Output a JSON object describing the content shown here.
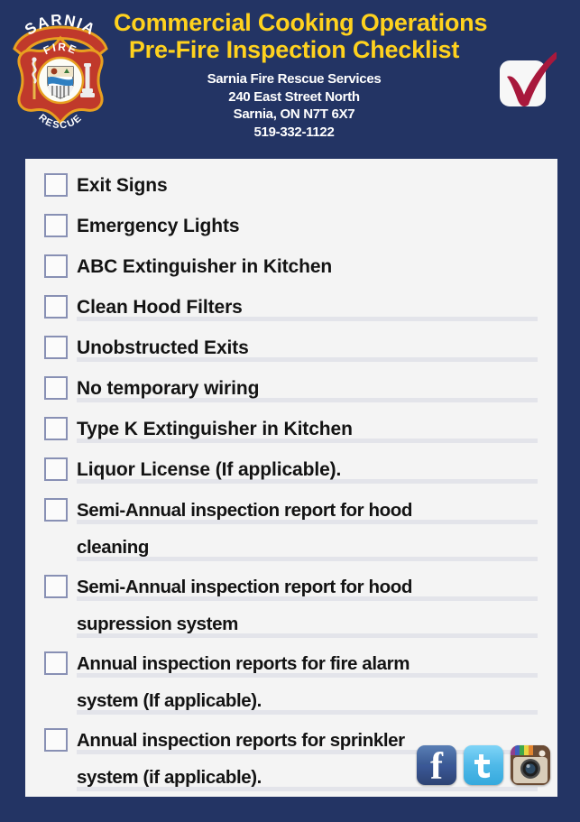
{
  "document": {
    "background_color": "#233464",
    "panel_color": "#F4F4F4",
    "accent_yellow": "#FFD21E",
    "checkmark_color": "#A8183C"
  },
  "header": {
    "title_line_1": "Commercial Cooking Operations",
    "title_line_2": "Pre-Fire Inspection Checklist",
    "crest_text": {
      "top_band": "SARNIA",
      "upper": "FIRE",
      "lower": "RESCUE"
    },
    "address": [
      "Sarnia Fire Rescue Services",
      "240 East Street North",
      "Sarnia, ON N7T 6X7",
      "519-332-1122"
    ],
    "check_logo_name": "checkmark-logo"
  },
  "checklist": {
    "items": [
      {
        "lines": [
          "Exit Signs"
        ],
        "rules": 0
      },
      {
        "lines": [
          "Emergency Lights"
        ],
        "rules": 0
      },
      {
        "lines": [
          "ABC Extinguisher in Kitchen"
        ],
        "rules": 0
      },
      {
        "lines": [
          "Clean Hood Filters"
        ],
        "rules": 1
      },
      {
        "lines": [
          "Unobstructed Exits"
        ],
        "rules": 1
      },
      {
        "lines": [
          "No temporary wiring"
        ],
        "rules": 1
      },
      {
        "lines": [
          "Type K Extinguisher in Kitchen"
        ],
        "rules": 1
      },
      {
        "lines": [
          "Liquor License (If applicable)."
        ],
        "rules": 1
      },
      {
        "lines": [
          "Semi-Annual inspection report for hood",
          "cleaning"
        ],
        "rules": 2
      },
      {
        "lines": [
          "Semi-Annual inspection report for hood",
          "supression system"
        ],
        "rules": 2
      },
      {
        "lines": [
          "Annual inspection reports for fire alarm",
          "system (If applicable)."
        ],
        "rules": 2
      },
      {
        "lines": [
          "Annual inspection reports for sprinkler",
          "system (if applicable)."
        ],
        "rules": 2
      }
    ]
  },
  "social": {
    "facebook_glyph": "f",
    "twitter_glyph": "t",
    "items": [
      {
        "name": "facebook-icon",
        "label": "Facebook"
      },
      {
        "name": "twitter-icon",
        "label": "Twitter"
      },
      {
        "name": "instagram-icon",
        "label": "Instagram"
      }
    ]
  }
}
